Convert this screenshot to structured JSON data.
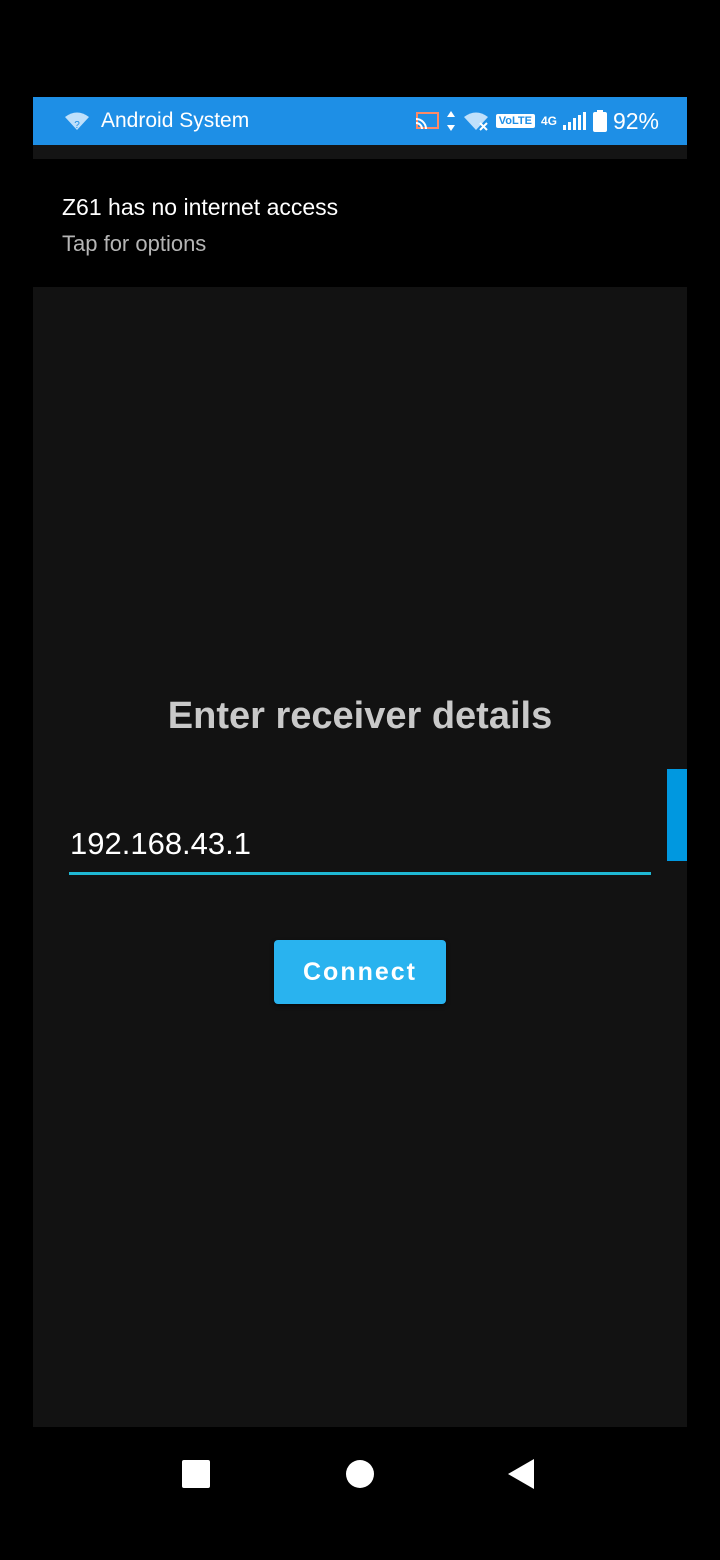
{
  "status_bar": {
    "app_name": "Android System",
    "volte": "VoLTE",
    "network": "4G",
    "battery_percent": "92%",
    "accent_color": "#1e8fe6"
  },
  "notification": {
    "title": "Z61 has no internet access",
    "subtitle": "Tap for options"
  },
  "form": {
    "heading": "Enter receiver details",
    "ip_value": "192.168.43.1",
    "connect_label": "Connect"
  },
  "nav": {
    "icons": [
      "recents-square-icon",
      "home-circle-icon",
      "back-triangle-icon"
    ]
  }
}
